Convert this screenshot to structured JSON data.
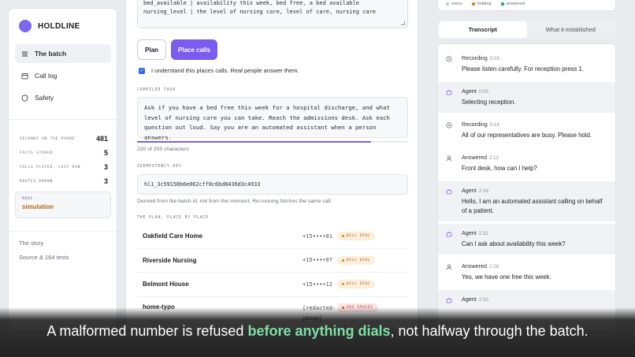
{
  "brand": {
    "name": "HOLDLINE",
    "color": "#7b68ee"
  },
  "nav": [
    {
      "label": "The batch",
      "icon": "list-icon",
      "active": true
    },
    {
      "label": "Call log",
      "icon": "calendar-icon",
      "active": false
    },
    {
      "label": "Safety",
      "icon": "shield-icon",
      "active": false
    }
  ],
  "stats": [
    {
      "label": "Seconds on the phone",
      "value": "481"
    },
    {
      "label": "Facts stored",
      "value": "5"
    },
    {
      "label": "Calls placed, last run",
      "value": "3"
    },
    {
      "label": "Routes known",
      "value": "3"
    }
  ],
  "mode": {
    "label": "Mode",
    "value": "simulation"
  },
  "side_links": [
    "The story",
    "Source & 164 tests"
  ],
  "top_code": {
    "line1": "bed_available | availability this week, bed free, a bed available",
    "line2": "nursing_level | the level of nursing care, level of care, nursing care"
  },
  "buttons": {
    "plan": "Plan",
    "place_calls": "Place calls"
  },
  "confirm": {
    "label": "I understand this places calls. Real people answer them.",
    "checked": true
  },
  "compiled_task": {
    "label": "Compiled task",
    "text": "Ask if you have a bed free this week for a hospital discharge, and what level of nursing care you can take. Reach the admissions desk. Ask each question out loud. Say you are an automated assistant when a person answers.",
    "char_count": "220 of 255 characters",
    "used": 220,
    "max": 255
  },
  "idempotency": {
    "label": "Idempotency key",
    "value": "hl1_3c59150b6e062cff0c6bd8436d3c4933",
    "note": "Derived from the batch id, not from the moment. Re-running fetches the same call."
  },
  "plan": {
    "label": "The plan, place by place",
    "places": [
      {
        "name": "Oakfield Care Home",
        "phone": "+15••••01",
        "status": "WILL DIAL",
        "kind": "warn"
      },
      {
        "name": "Riverside Nursing",
        "phone": "+15••••07",
        "status": "WILL DIAL",
        "kind": "warn"
      },
      {
        "name": "Belmont House",
        "phone": "+15••••12",
        "status": "WILL DIAL",
        "kind": "warn"
      },
      {
        "name": "home-typo",
        "phone": "[redacted-phone]",
        "status": "HAS SPACES",
        "kind": "err"
      }
    ]
  },
  "legend": [
    {
      "label": "menu",
      "color": "#c9ccd3"
    },
    {
      "label": "holding",
      "color": "#d98a1c"
    },
    {
      "label": "answered",
      "color": "#3aa46a"
    }
  ],
  "tabs": [
    "Transcript",
    "What it established"
  ],
  "transcript": [
    {
      "speaker": "Recording",
      "time": "0:03",
      "text": "Please listen carefully. For reception press 1.",
      "kind": "rec"
    },
    {
      "speaker": "Agent",
      "time": "0:09",
      "text": "Selecting reception.",
      "kind": "agent"
    },
    {
      "speaker": "Recording",
      "time": "0:14",
      "text": "All of our representatives are busy. Please hold.",
      "kind": "rec"
    },
    {
      "speaker": "Answered",
      "time": "2:12",
      "text": "Front desk, how can I help?",
      "kind": "person"
    },
    {
      "speaker": "Agent",
      "time": "2:16",
      "text": "Hello, I am an automated assistant calling on behalf of a patient.",
      "kind": "agent"
    },
    {
      "speaker": "Agent",
      "time": "2:22",
      "text": "Can I ask about availability this week?",
      "kind": "agent"
    },
    {
      "speaker": "Answered",
      "time": "2:28",
      "text": "Yes, we have one free this week.",
      "kind": "person"
    },
    {
      "speaker": "Agent",
      "time": "2:50",
      "text": "",
      "kind": "agent"
    }
  ],
  "caption": {
    "pre": "A malformed number is refused ",
    "highlight": "before anything dials",
    "post": ", not halfway through the batch.",
    "highlight_color": "#7ee0a5"
  }
}
